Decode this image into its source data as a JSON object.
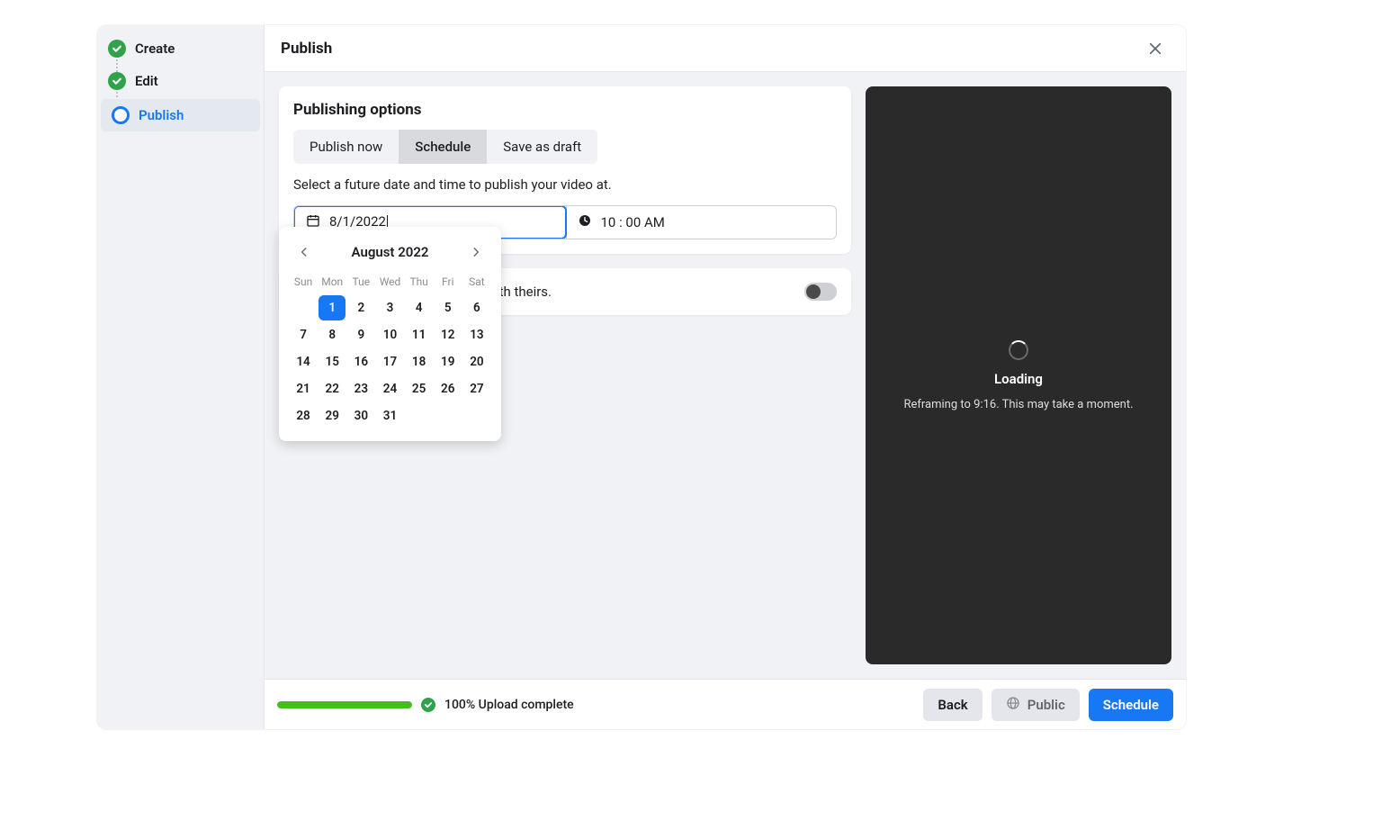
{
  "sidebar": {
    "steps": [
      {
        "label": "Create",
        "status": "done"
      },
      {
        "label": "Edit",
        "status": "done"
      },
      {
        "label": "Publish",
        "status": "active"
      }
    ]
  },
  "header": {
    "title": "Publish"
  },
  "options": {
    "title": "Publishing options",
    "tabs": {
      "now": "Publish now",
      "schedule": "Schedule",
      "draft": "Save as draft",
      "selected": "schedule"
    },
    "hint": "Select a future date and time to publish your video at.",
    "date_value": "8/1/2022",
    "time_value": "10 : 00 AM"
  },
  "calendar": {
    "month_label": "August 2022",
    "dow": [
      "Sun",
      "Mon",
      "Tue",
      "Wed",
      "Thu",
      "Fri",
      "Sat"
    ],
    "first_day_index": 1,
    "days_in_month": 31,
    "selected_day": 1
  },
  "remix": {
    "text_suffix": "eate a reel that plays your video with theirs.",
    "enabled": false
  },
  "preview": {
    "loading_title": "Loading",
    "loading_subtitle": "Reframing to 9:16. This may take a moment."
  },
  "footer": {
    "upload_status": "100% Upload complete",
    "back": "Back",
    "public": "Public",
    "schedule": "Schedule"
  }
}
